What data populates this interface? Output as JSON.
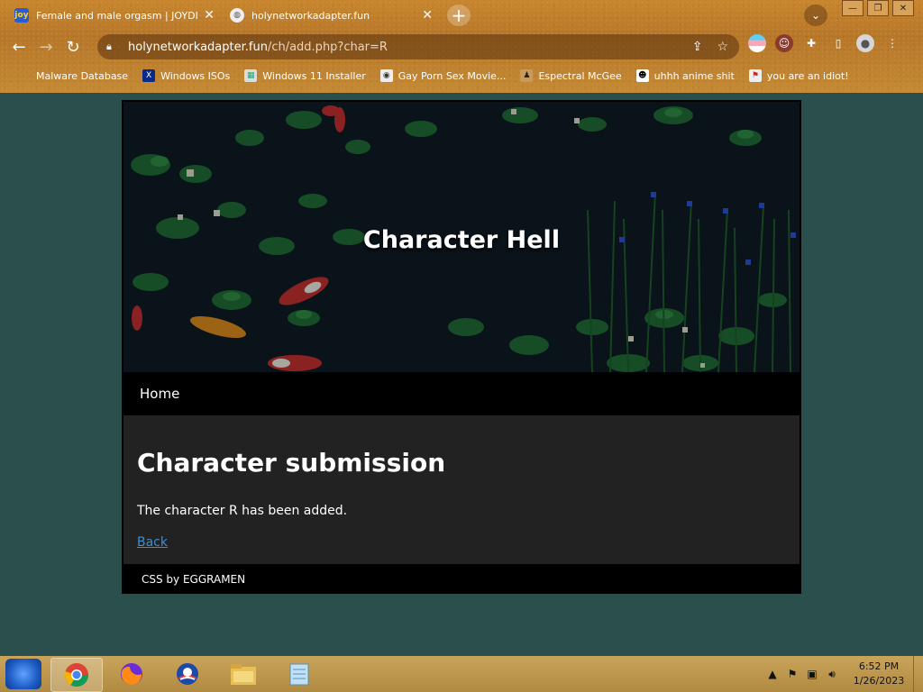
{
  "browser": {
    "tabs": [
      {
        "title": "Female and male orgasm | JOYDI",
        "favicon": "joy-icon",
        "favicon_text": "joy"
      },
      {
        "title": "holynetworkadapter.fun",
        "favicon": "globe-icon"
      }
    ],
    "url_host": "holynetworkadapter.fun",
    "url_path": "/ch/add.php?char=R",
    "bookmarks": [
      {
        "label": "Malware Database"
      },
      {
        "label": "Windows ISOs"
      },
      {
        "label": "Windows 11 Installer"
      },
      {
        "label": "Gay Porn Sex Movie..."
      },
      {
        "label": "Espectral McGee"
      },
      {
        "label": "uhhh anime shit"
      },
      {
        "label": "you are an idiot!"
      }
    ]
  },
  "site": {
    "title": "Character Hell",
    "nav": {
      "home": "Home"
    },
    "heading": "Character submission",
    "message": "The character R has been added.",
    "back_link": "Back",
    "footer": "CSS by EGGRAMEN"
  },
  "taskbar": {
    "time": "6:52 PM",
    "date": "1/26/2023"
  },
  "colors": {
    "page_bg": "#2b4f4c",
    "link": "#3c8dd6",
    "content_bg": "#222222"
  }
}
